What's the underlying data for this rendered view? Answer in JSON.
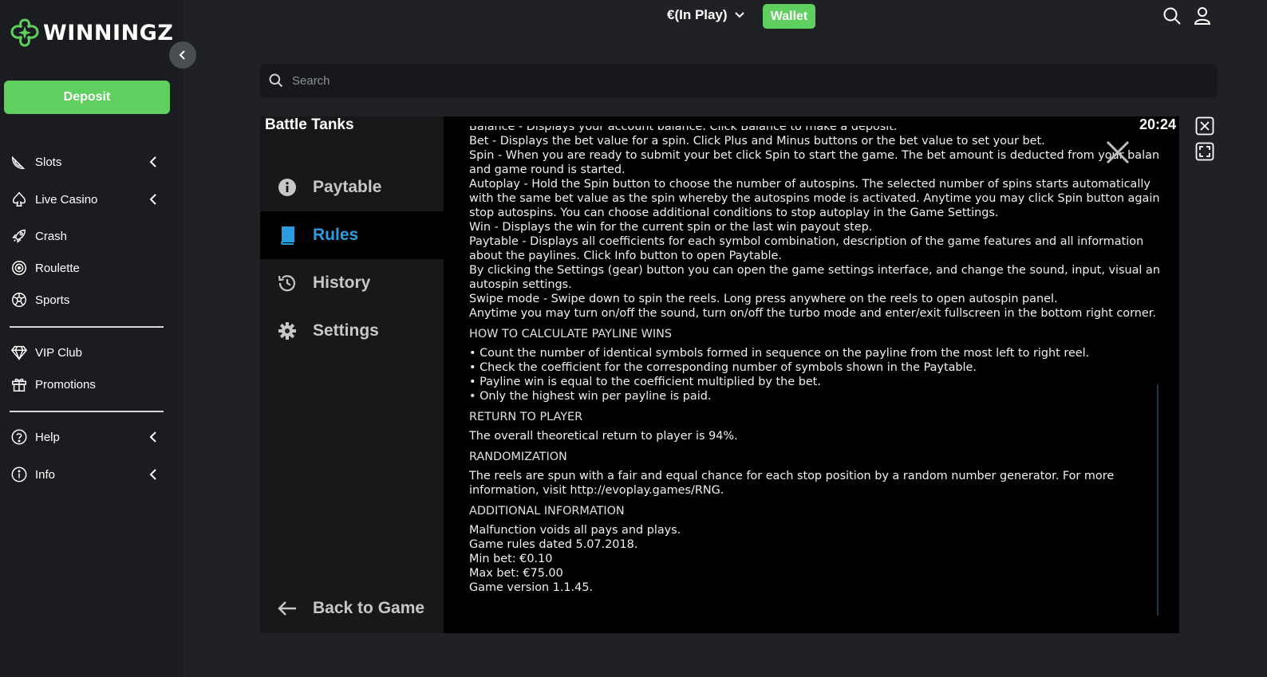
{
  "brand": {
    "name": "WINNINGZ"
  },
  "sidebar": {
    "deposit_label": "Deposit",
    "items": [
      {
        "label": "Slots",
        "icon": "watermelon-icon",
        "has_chevron": true
      },
      {
        "label": "Live Casino",
        "icon": "spade-icon",
        "has_chevron": true
      },
      {
        "label": "Crash",
        "icon": "rocket-icon",
        "has_chevron": false
      },
      {
        "label": "Roulette",
        "icon": "roulette-icon",
        "has_chevron": false
      },
      {
        "label": "Sports",
        "icon": "soccer-ball-icon",
        "has_chevron": false
      },
      {
        "label": "VIP Club",
        "icon": "diamond-icon",
        "has_chevron": false
      },
      {
        "label": "Promotions",
        "icon": "gift-icon",
        "has_chevron": false
      },
      {
        "label": "Help",
        "icon": "question-icon",
        "has_chevron": true
      },
      {
        "label": "Info",
        "icon": "info-icon",
        "has_chevron": true
      }
    ]
  },
  "header": {
    "balance": "€(In Play)",
    "wallet_label": "Wallet"
  },
  "search": {
    "placeholder": "Search"
  },
  "game": {
    "title": "Battle Tanks",
    "clock": "20:24",
    "menu": [
      {
        "label": "Paytable",
        "icon": "info-circle-icon",
        "active": false
      },
      {
        "label": "Rules",
        "icon": "book-icon",
        "active": true
      },
      {
        "label": "History",
        "icon": "history-icon",
        "active": false
      },
      {
        "label": "Settings",
        "icon": "gear-icon",
        "active": false
      }
    ],
    "back_label": "Back to Game",
    "rules": {
      "top_lines": [
        "Balance - Displays your account balance. Click Balance to make a deposit.",
        "Bet - Displays the bet value for a spin. Click Plus and Minus buttons or the bet value to set your bet.",
        "Spin - When you are ready to submit your bet click Spin to start the game. The bet amount is deducted from your balance",
        "and game round is started.",
        "Autoplay - Hold the Spin button to choose the number of autospins. The selected number of spins starts automatically",
        "with the same bet value as the spin whereby the autospins mode is activated. Anytime you may click Spin button again to",
        "stop autospins. You can choose additional conditions to stop autoplay in the Game Settings.",
        "Win - Displays the win for the current spin or the last win payout step.",
        "Paytable - Displays all coefficients for each symbol combination, description of the game features and all information",
        "about the paylines. Click Info button to open Paytable.",
        "By clicking the Settings (gear) button you can open the game settings interface, and change the sound, input, visual and",
        "autospin settings.",
        "Swipe mode - Swipe down to spin the reels. Long press anywhere on the reels to open autospin panel.",
        "Anytime you may turn on/off the sound, turn on/off the turbo mode and enter/exit fullscreen in the bottom right corner."
      ],
      "payline_heading": "HOW TO CALCULATE PAYLINE WINS",
      "payline_lines": [
        "• Count the number of identical symbols formed in sequence on the payline from the most left to right reel.",
        "• Check the coefficient for the corresponding number of symbols shown in the Paytable.",
        "• Payline win is equal to the coefficient multiplied by the bet.",
        "• Only the highest win per payline is paid."
      ],
      "rtp_heading": "RETURN TO PLAYER",
      "rtp_lines": [
        "The overall theoretical return to player is 94%."
      ],
      "random_heading": "RANDOMIZATION",
      "random_lines": [
        "The reels are spun with a fair and equal chance for each stop position by a random number generator. For more",
        "information, visit http://evoplay.games/RNG."
      ],
      "additional_heading": "ADDITIONAL INFORMATION",
      "additional_lines": [
        "Malfunction voids all pays and plays.",
        "Game rules dated 5.07.2018.",
        "Min bet: €0.10",
        "Max bet: €75.00",
        "Game version 1.1.45."
      ]
    }
  },
  "colors": {
    "accent_green": "#5fd05f",
    "active_blue": "#2c9ce0",
    "background": "#1f2124"
  }
}
